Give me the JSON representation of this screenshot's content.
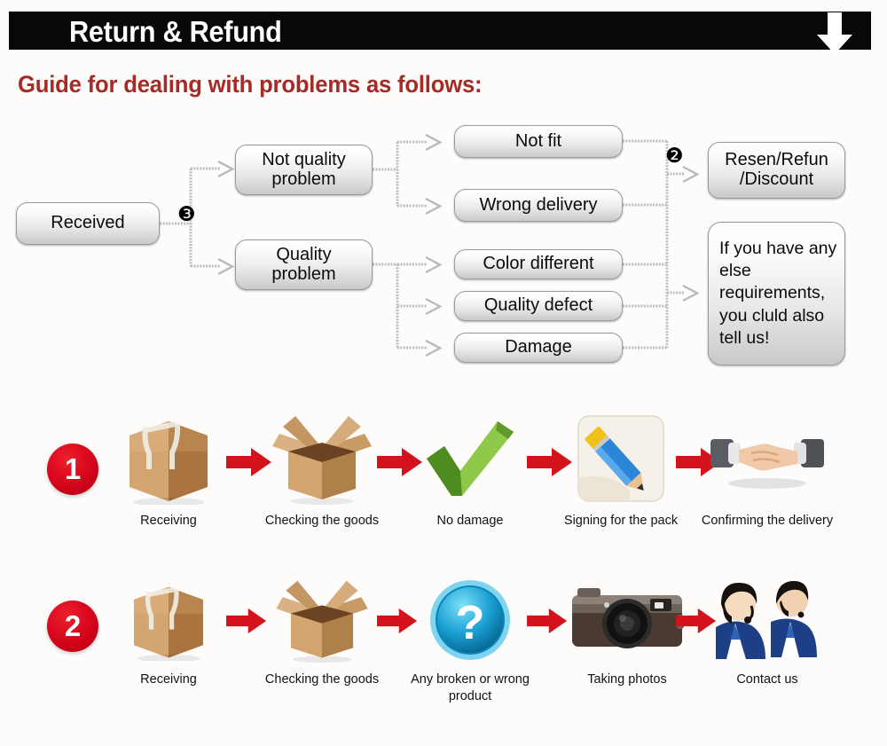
{
  "header": {
    "title": "Return & Refund",
    "arrow_icon": "down-arrow-icon",
    "bar_color": "#080808",
    "title_color": "#ffffff"
  },
  "guide": {
    "heading": "Guide for dealing with problems as follows:",
    "heading_color": "#a62b26"
  },
  "flowchart": {
    "nodes": {
      "received": "Received",
      "not_quality_problem": "Not quality\nproblem",
      "quality_problem": "Quality\nproblem",
      "not_fit": "Not fit",
      "wrong_delivery": "Wrong delivery",
      "color_different": "Color different",
      "quality_defect": "Quality defect",
      "damage": "Damage",
      "resend_refund_discount": "Resen/Refun\n/Discount",
      "if_you_have": "If you have any else requirements, you cluld also tell us!"
    },
    "badges": {
      "after_received": "❸",
      "before_resend": "❷"
    },
    "connector_color": "#b5b5b5",
    "node_border_color": "#9a9a9a"
  },
  "steps": {
    "row1": {
      "number": "1",
      "cells": [
        {
          "icon": "closed-box-icon",
          "caption": "Receiving"
        },
        {
          "icon": "open-box-icon",
          "caption": "Checking the goods"
        },
        {
          "icon": "green-check-icon",
          "caption": "No damage"
        },
        {
          "icon": "pencil-signing-icon",
          "caption": "Signing for the pack"
        },
        {
          "icon": "handshake-icon",
          "caption": "Confirming the delivery"
        }
      ]
    },
    "row2": {
      "number": "2",
      "cells": [
        {
          "icon": "closed-box-icon",
          "caption": "Receiving"
        },
        {
          "icon": "open-box-icon",
          "caption": "Checking the goods"
        },
        {
          "icon": "question-mark-icon",
          "caption": "Any broken or wrong product"
        },
        {
          "icon": "camera-icon",
          "caption": "Taking photos"
        },
        {
          "icon": "support-people-icon",
          "caption": "Contact us"
        }
      ]
    },
    "arrow_icon": "red-right-arrow-icon",
    "arrow_color": "#d4121c",
    "number_badge_color": "#d4041a"
  }
}
